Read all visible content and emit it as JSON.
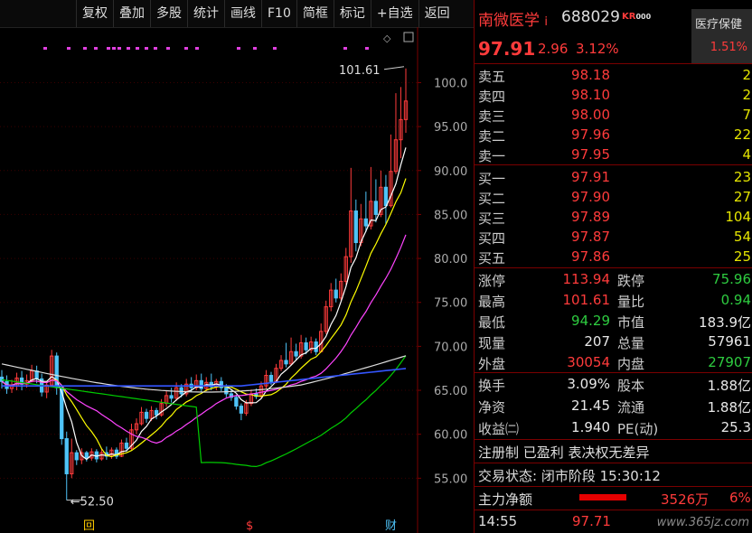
{
  "toolbar": {
    "buttons": [
      "复权",
      "叠加",
      "多股",
      "统计",
      "画线",
      "F10",
      "简框",
      "标记",
      "+自选",
      "返回"
    ]
  },
  "chart": {
    "y_ticks": [
      "100.0",
      "95.00",
      "90.00",
      "85.00",
      "80.00",
      "75.00",
      "70.00",
      "65.00",
      "60.00",
      "55.00"
    ],
    "high_label": "101.61",
    "low_label": "52.50",
    "markers": [
      "回",
      "$",
      "财"
    ],
    "colors": {
      "up": "#ff3b3b",
      "down": "#4fc3f7",
      "ma5": "#ffffff",
      "ma10": "#ffff00",
      "ma20": "#ff44ff",
      "ma60": "#00cc00",
      "ma120": "#dddddd",
      "ma250": "#3355ff"
    }
  },
  "chart_data": {
    "type": "candlestick",
    "y_range": [
      50,
      102
    ],
    "high": 101.61,
    "low": 52.5,
    "candles": [
      [
        66.5,
        66.0,
        67.3,
        65.2
      ],
      [
        66.0,
        65.2,
        66.7,
        64.6
      ],
      [
        65.2,
        65.5,
        66.2,
        64.7
      ],
      [
        65.5,
        66.4,
        67.0,
        65.0
      ],
      [
        66.4,
        65.7,
        67.2,
        65.0
      ],
      [
        65.7,
        66.1,
        66.8,
        65.3
      ],
      [
        66.1,
        67.2,
        67.9,
        65.9
      ],
      [
        67.2,
        66.3,
        67.8,
        65.8
      ],
      [
        66.3,
        64.8,
        66.9,
        64.3
      ],
      [
        64.8,
        65.6,
        66.0,
        64.1
      ],
      [
        65.6,
        68.9,
        69.6,
        65.4
      ],
      [
        68.9,
        65.3,
        69.3,
        64.5
      ],
      [
        65.3,
        59.5,
        65.4,
        58.8
      ],
      [
        59.5,
        55.5,
        60.3,
        52.5
      ],
      [
        55.5,
        57.9,
        59.5,
        55.0
      ],
      [
        57.9,
        57.1,
        58.2,
        56.5
      ],
      [
        57.1,
        57.9,
        58.4,
        56.6
      ],
      [
        57.9,
        57.3,
        58.1,
        56.9
      ],
      [
        57.3,
        58.0,
        58.4,
        57.0
      ],
      [
        58.0,
        57.2,
        58.3,
        56.8
      ],
      [
        57.2,
        57.9,
        58.3,
        57.0
      ],
      [
        57.9,
        57.5,
        58.6,
        57.1
      ],
      [
        57.5,
        58.2,
        58.5,
        57.2
      ],
      [
        58.2,
        57.5,
        58.5,
        57.2
      ],
      [
        57.5,
        59.0,
        59.4,
        57.4
      ],
      [
        59.0,
        58.4,
        59.6,
        58.0
      ],
      [
        58.4,
        60.5,
        61.2,
        58.2
      ],
      [
        60.5,
        61.2,
        61.8,
        60.0
      ],
      [
        61.2,
        62.5,
        63.1,
        61.0
      ],
      [
        62.5,
        61.8,
        62.9,
        61.3
      ],
      [
        61.8,
        62.7,
        63.2,
        61.5
      ],
      [
        62.7,
        62.2,
        63.0,
        61.7
      ],
      [
        62.2,
        63.5,
        64.0,
        62.0
      ],
      [
        63.5,
        64.4,
        65.0,
        63.1
      ],
      [
        64.4,
        64.1,
        65.3,
        63.6
      ],
      [
        64.1,
        65.3,
        65.9,
        63.8
      ],
      [
        65.3,
        64.6,
        65.7,
        64.2
      ],
      [
        64.6,
        65.7,
        66.3,
        64.3
      ],
      [
        65.7,
        65.3,
        66.5,
        64.8
      ],
      [
        65.3,
        66.1,
        66.8,
        65.0
      ],
      [
        66.1,
        65.2,
        66.9,
        64.8
      ],
      [
        65.2,
        65.9,
        66.5,
        64.9
      ],
      [
        65.9,
        65.4,
        66.9,
        65.0
      ],
      [
        65.4,
        66.0,
        66.3,
        65.0
      ],
      [
        66.0,
        65.3,
        66.5,
        64.9
      ],
      [
        65.3,
        64.6,
        65.7,
        64.2
      ],
      [
        64.6,
        64.2,
        65.1,
        63.8
      ],
      [
        64.2,
        63.2,
        64.5,
        62.8
      ],
      [
        63.2,
        62.4,
        63.5,
        61.6
      ],
      [
        62.4,
        63.5,
        63.9,
        62.1
      ],
      [
        63.5,
        64.6,
        65.1,
        63.2
      ],
      [
        64.6,
        64.3,
        65.2,
        64.0
      ],
      [
        64.3,
        65.5,
        66.0,
        64.1
      ],
      [
        65.5,
        66.7,
        67.3,
        65.2
      ],
      [
        66.7,
        66.0,
        67.1,
        65.6
      ],
      [
        66.0,
        67.5,
        68.0,
        65.8
      ],
      [
        67.5,
        68.4,
        69.0,
        67.2
      ],
      [
        68.4,
        68.0,
        70.4,
        67.6
      ],
      [
        68.0,
        69.4,
        71.0,
        67.8
      ],
      [
        69.4,
        68.9,
        70.3,
        68.4
      ],
      [
        68.9,
        70.4,
        71.3,
        68.6
      ],
      [
        70.4,
        69.6,
        71.0,
        69.1
      ],
      [
        69.6,
        70.5,
        71.1,
        69.2
      ],
      [
        70.5,
        69.4,
        70.9,
        69.0
      ],
      [
        69.4,
        71.7,
        72.6,
        69.3
      ],
      [
        71.7,
        74.5,
        75.2,
        71.4
      ],
      [
        74.5,
        76.4,
        77.2,
        74.0
      ],
      [
        76.4,
        75.5,
        77.7,
        75.0
      ],
      [
        75.5,
        77.4,
        78.3,
        75.2
      ],
      [
        77.4,
        80.2,
        81.2,
        77.0
      ],
      [
        80.2,
        85.4,
        90.3,
        79.5
      ],
      [
        85.4,
        81.8,
        86.7,
        80.8
      ],
      [
        81.8,
        84.5,
        86.2,
        81.4
      ],
      [
        84.5,
        83.7,
        87.6,
        83.0
      ],
      [
        83.7,
        86.5,
        90.4,
        83.3
      ],
      [
        86.5,
        85.0,
        89.0,
        84.1
      ],
      [
        85.0,
        88.1,
        90.0,
        84.7
      ],
      [
        88.1,
        86.0,
        89.5,
        83.9
      ],
      [
        86.0,
        89.9,
        94.1,
        85.8
      ],
      [
        89.9,
        93.5,
        98.8,
        89.6
      ],
      [
        93.5,
        95.8,
        99.5,
        91.4
      ],
      [
        95.8,
        97.91,
        101.61,
        94.29
      ]
    ],
    "ma5_color": "#ffffff",
    "ma10_color": "#ffff00",
    "ma20_color": "#ff44ff",
    "ma60_color": "#00cc00",
    "ma120_color": "#dddddd",
    "ma250_color": "#3355ff"
  },
  "stock": {
    "name": "南微医学",
    "info_icon": "i",
    "code": "688029",
    "badge": "KR",
    "badge2": "000",
    "price": "97.91",
    "change": "2.96",
    "change_pct": "3.12%",
    "sector": "医疗保健",
    "sector_pct": "1.51%"
  },
  "orderbook": {
    "asks": [
      {
        "label": "卖五",
        "price": "98.18",
        "vol": "2"
      },
      {
        "label": "卖四",
        "price": "98.10",
        "vol": "2"
      },
      {
        "label": "卖三",
        "price": "98.00",
        "vol": "7"
      },
      {
        "label": "卖二",
        "price": "97.96",
        "vol": "22"
      },
      {
        "label": "卖一",
        "price": "97.95",
        "vol": "4"
      }
    ],
    "bids": [
      {
        "label": "买一",
        "price": "97.91",
        "vol": "23"
      },
      {
        "label": "买二",
        "price": "97.90",
        "vol": "27"
      },
      {
        "label": "买三",
        "price": "97.89",
        "vol": "104"
      },
      {
        "label": "买四",
        "price": "97.87",
        "vol": "54"
      },
      {
        "label": "买五",
        "price": "97.86",
        "vol": "25"
      }
    ]
  },
  "stats": [
    {
      "l1": "涨停",
      "v1": "113.94",
      "l2": "跌停",
      "v2": "75.96"
    },
    {
      "l1": "最高",
      "v1": "101.61",
      "l2": "量比",
      "v2": "0.94"
    },
    {
      "l1": "最低",
      "v1": "94.29",
      "l2": "市值",
      "v2": "183.9亿"
    },
    {
      "l1": "现量",
      "v1": "207",
      "l2": "总量",
      "v2": "57961"
    },
    {
      "l1": "外盘",
      "v1": "30054",
      "l2": "内盘",
      "v2": "27907"
    }
  ],
  "stats2": [
    {
      "l1": "换手",
      "v1": "3.09%",
      "l2": "股本",
      "v2": "1.88亿"
    },
    {
      "l1": "净资",
      "v1": "21.45",
      "l2": "流通",
      "v2": "1.88亿"
    },
    {
      "l1": "收益㈡",
      "v1": "1.940",
      "l2": "PE(动)",
      "v2": "25.3"
    }
  ],
  "notes": {
    "tags": "注册制 已盈利 表决权无差异",
    "status": "交易状态: 闭市阶段 15:30:12",
    "flow_label": "主力净额",
    "flow_value": "3526万",
    "flow_pct": "6%"
  },
  "tick": {
    "time": "14:55",
    "price": "97.71"
  },
  "watermark": "www.365jz.com"
}
